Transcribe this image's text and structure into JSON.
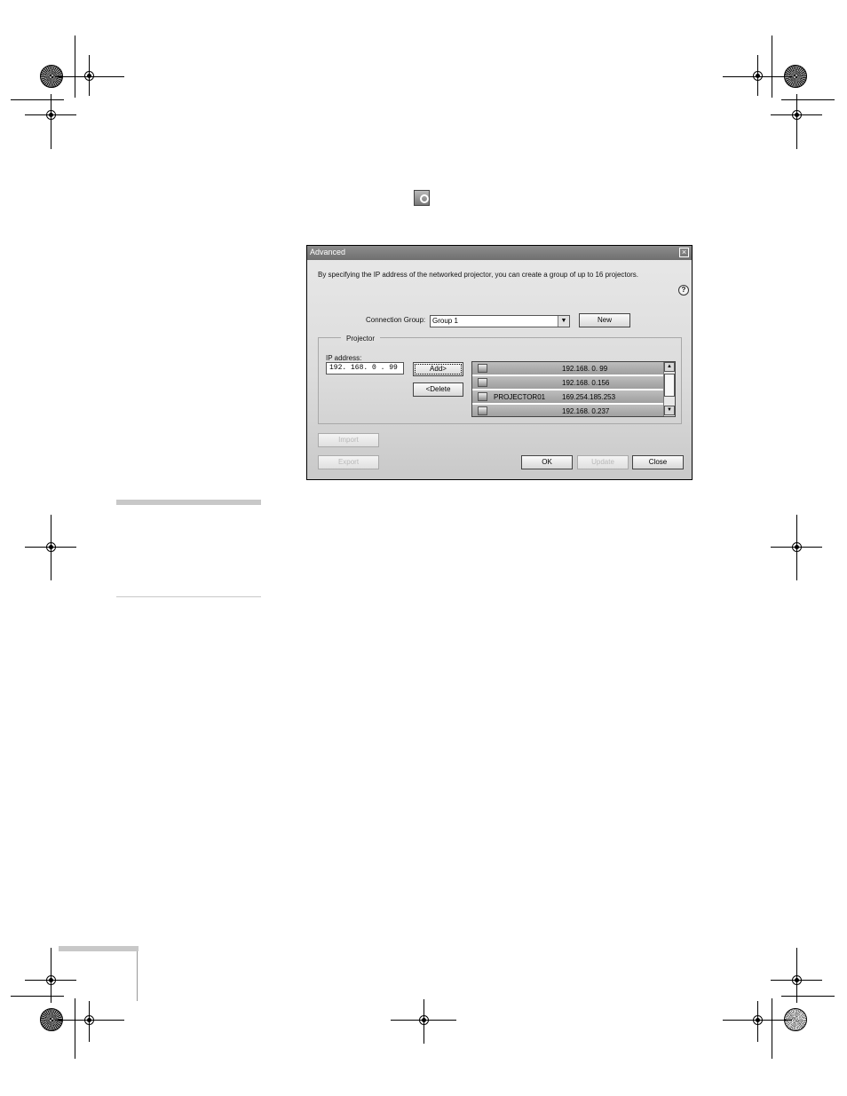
{
  "dialog": {
    "title": "Advanced",
    "close_glyph": "×",
    "description": "By specifying the IP address of the networked projector, you can create a group of up to 16 projectors.",
    "help_glyph": "?",
    "connection_group_label": "Connection Group:",
    "connection_group_value": "Group 1",
    "dropdown_glyph": "▼",
    "new_label": "New",
    "projector_group_label": "Projector",
    "ip_address_label": "IP address:",
    "ip_address_value": "192. 168.  0  . 99",
    "add_label": "Add>",
    "delete_label": "<Delete",
    "scroll_up_glyph": "▲",
    "scroll_down_glyph": "▼",
    "projectors": [
      {
        "icon": "search-projector-icon",
        "name": "",
        "ip": "192.168.  0. 99"
      },
      {
        "icon": "unknown-projector-icon",
        "name": "",
        "ip": "192.168.  0.156"
      },
      {
        "icon": "projector-icon",
        "name": "PROJECTOR01",
        "ip": "169.254.185.253"
      },
      {
        "icon": "unknown-projector-icon",
        "name": "",
        "ip": "192.168.  0.237"
      }
    ],
    "import_label": "Import",
    "export_label": "Export",
    "ok_label": "OK",
    "update_label": "Update",
    "close_label": "Close"
  },
  "icons": {
    "toolbar_icon": "advanced-search-icon"
  },
  "colors": {
    "titlebar": "#7a7a7a",
    "list_row": "#b0b0b0",
    "note_bar": "#c8c8c8"
  }
}
